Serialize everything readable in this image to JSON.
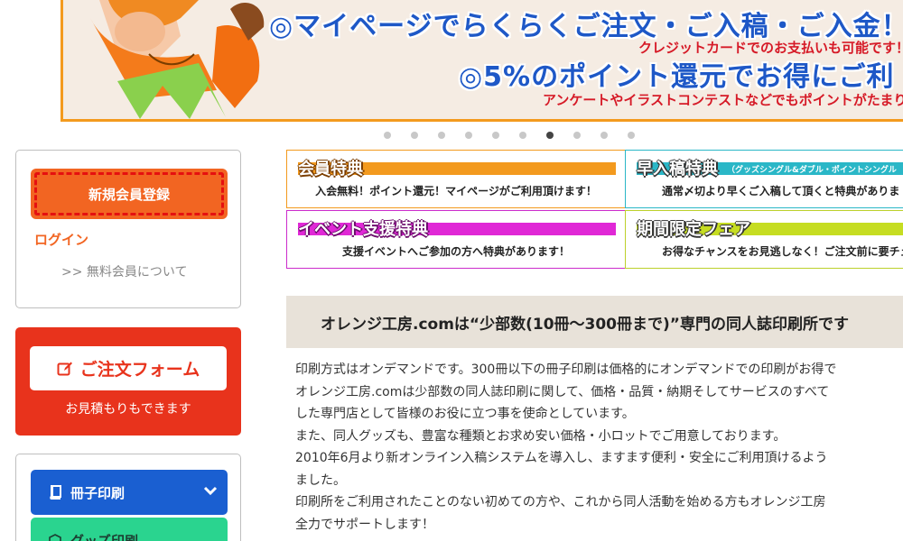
{
  "banner": {
    "line1": "◎マイページでらくらくご注文・ご入稿・ご入金！",
    "line2": "クレジットカードでのお支払いも可能です！",
    "line3": "◎5%のポイント還元でお得にご利",
    "line4": "アンケートやイラストコンテストなどでもポイントがたまり"
  },
  "carousel": {
    "count": 10,
    "active": 7
  },
  "member": {
    "register_label": "新規会員登録",
    "login_label": "ログイン",
    "free_member_label": ">> 無料会員について"
  },
  "order": {
    "button_label": "ご注文フォーム",
    "sub_label": "お見積もりもできます"
  },
  "categories": {
    "item1_label": "冊子印刷",
    "item2_label": "グッズ印刷"
  },
  "features": {
    "f1_title": "会員特典",
    "f1_desc": "入会無料！ポイント還元！マイページがご利用頂けます！",
    "f2_title": "早入稿特典",
    "f2_note": "（グッズシングル&ダブル・ポイントシングル",
    "f2_desc": "通常〆切より早くご入稿して頂くと特典がありま",
    "f3_title": "イベント支援特典",
    "f3_desc": "支援イベントへご参加の方へ特典があります！",
    "f4_title": "期間限定フェア",
    "f4_desc": "お得なチャンスをお見逃しなく！ご注文前に要チェ"
  },
  "about": {
    "heading": "オレンジ工房.comは“少部数(10冊～300冊まで)”専門の同人誌印刷所です",
    "lines": [
      "印刷方式はオンデマンドです。300冊以下の冊子印刷は価格的にオンデマンドでの印刷がお得で",
      "オレンジ工房.comは少部数の同人誌印刷に関して、価格・品質・納期そしてサービスのすべて",
      "した専門店として皆様のお役に立つ事を使命としています。",
      "また、同人グッズも、豊富な種類とお求め安い価格・小ロットでご用意しております。",
      "2010年6月より新オンライン入稿システムを導入し、ますます便利・安全にご利用頂けるよう",
      "ました。",
      "印刷所をご利用されたことのない初めての方や、これから同人活動を始める方もオレンジ工房",
      "全力でサポートします！"
    ]
  },
  "colors": {
    "brand_orange": "#f26522",
    "order_red": "#e8331c",
    "banner_blue": "#1e58c7",
    "cat_blue": "#1a5fd1",
    "cat_green": "#2ad48f"
  }
}
